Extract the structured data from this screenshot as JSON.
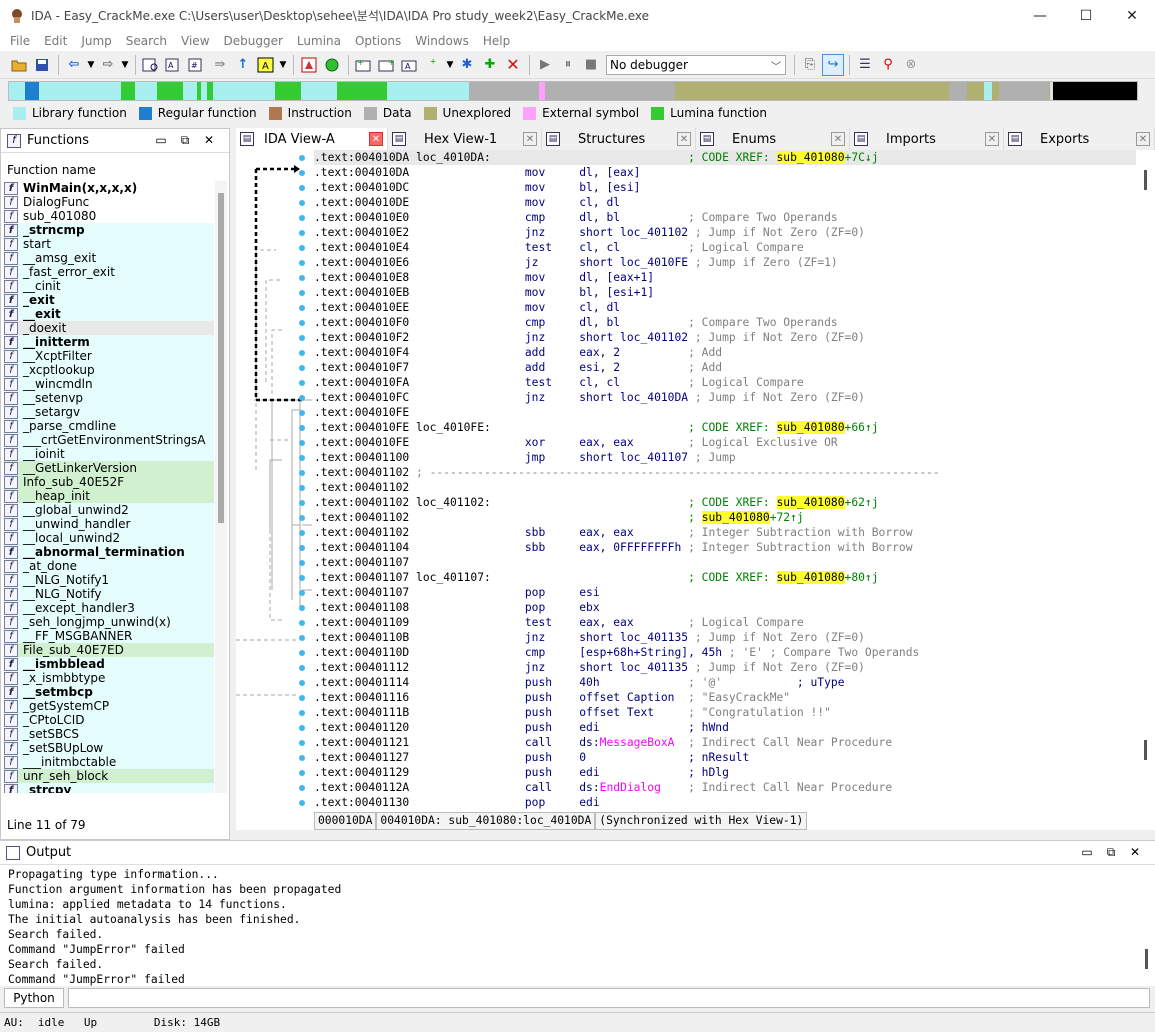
{
  "window": {
    "title": "IDA - Easy_CrackMe.exe C:\\Users\\user\\Desktop\\sehee\\분석\\IDA\\IDA Pro study_week2\\Easy_CrackMe.exe",
    "minimize": "—",
    "maximize": "☐",
    "close": "✕"
  },
  "menu": [
    "File",
    "Edit",
    "Jump",
    "Search",
    "View",
    "Debugger",
    "Lumina",
    "Options",
    "Windows",
    "Help"
  ],
  "toolbar": {
    "debugger_select": "No debugger"
  },
  "legend": [
    {
      "label": "Library function",
      "color": "#a8f0f0"
    },
    {
      "label": "Regular function",
      "color": "#1e7fd0"
    },
    {
      "label": "Instruction",
      "color": "#b07850"
    },
    {
      "label": "Data",
      "color": "#b0b0b0"
    },
    {
      "label": "Unexplored",
      "color": "#b0b070"
    },
    {
      "label": "External symbol",
      "color": "#ffa0ff"
    },
    {
      "label": "Lumina function",
      "color": "#33cc33"
    }
  ],
  "functions_panel": {
    "title": "Functions",
    "column_header": "Function name",
    "status": "Line 11 of 79",
    "items": [
      {
        "name": "WinMain(x,x,x,x)",
        "style": "b"
      },
      {
        "name": "DialogFunc",
        "style": ""
      },
      {
        "name": "sub_401080",
        "style": ""
      },
      {
        "name": "_strncmp",
        "style": "lib b"
      },
      {
        "name": "start",
        "style": "lib"
      },
      {
        "name": "__amsg_exit",
        "style": "lib"
      },
      {
        "name": "_fast_error_exit",
        "style": "lib"
      },
      {
        "name": "__cinit",
        "style": "lib"
      },
      {
        "name": "_exit",
        "style": "lib b"
      },
      {
        "name": "__exit",
        "style": "lib b"
      },
      {
        "name": "_doexit",
        "style": "sel"
      },
      {
        "name": "__initterm",
        "style": "lib b"
      },
      {
        "name": "__XcptFilter",
        "style": "lib"
      },
      {
        "name": "_xcptlookup",
        "style": "lib"
      },
      {
        "name": "__wincmdln",
        "style": "lib"
      },
      {
        "name": "__setenvp",
        "style": "lib"
      },
      {
        "name": "__setargv",
        "style": "lib"
      },
      {
        "name": "_parse_cmdline",
        "style": "lib"
      },
      {
        "name": "___crtGetEnvironmentStringsA",
        "style": "lib"
      },
      {
        "name": "__ioinit",
        "style": "lib"
      },
      {
        "name": "__GetLinkerVersion",
        "style": "lum"
      },
      {
        "name": "Info_sub_40E52F",
        "style": "lum"
      },
      {
        "name": "__heap_init",
        "style": "lum"
      },
      {
        "name": "__global_unwind2",
        "style": "lib"
      },
      {
        "name": "__unwind_handler",
        "style": "lib"
      },
      {
        "name": "__local_unwind2",
        "style": "lib"
      },
      {
        "name": "__abnormal_termination",
        "style": "lib b"
      },
      {
        "name": "_at_done",
        "style": "lib"
      },
      {
        "name": "__NLG_Notify1",
        "style": "lib"
      },
      {
        "name": "__NLG_Notify",
        "style": "lib"
      },
      {
        "name": "__except_handler3",
        "style": "lib"
      },
      {
        "name": "_seh_longjmp_unwind(x)",
        "style": "lib"
      },
      {
        "name": "__FF_MSGBANNER",
        "style": "lib"
      },
      {
        "name": "File_sub_40E7ED",
        "style": "lum"
      },
      {
        "name": "__ismbblead",
        "style": "lib b"
      },
      {
        "name": "_x_ismbbtype",
        "style": "lib"
      },
      {
        "name": "__setmbcp",
        "style": "lib b"
      },
      {
        "name": "_getSystemCP",
        "style": "lib"
      },
      {
        "name": "_CPtoLCID",
        "style": "lib"
      },
      {
        "name": "_setSBCS",
        "style": "lib"
      },
      {
        "name": "_setSBUpLow",
        "style": "lib"
      },
      {
        "name": "___initmbctable",
        "style": "lib"
      },
      {
        "name": "unr_seh_block",
        "style": "lum"
      },
      {
        "name": "_strcpy",
        "style": "lib b"
      }
    ]
  },
  "tabs": [
    {
      "label": "IDA View-A",
      "icon": "ida-view-icon",
      "active": true
    },
    {
      "label": "Hex View-1",
      "icon": "hex-view-icon",
      "active": false
    },
    {
      "label": "Structures",
      "icon": "structures-icon",
      "active": false
    },
    {
      "label": "Enums",
      "icon": "enums-icon",
      "active": false
    },
    {
      "label": "Imports",
      "icon": "imports-icon",
      "active": false
    },
    {
      "label": "Exports",
      "icon": "exports-icon",
      "active": false
    }
  ],
  "disasm": [
    [
      {
        "t": ".text:004010DA loc_4010DA:                             ",
        "c": "addr"
      },
      {
        "t": "; CODE XREF: ",
        "c": "xr"
      },
      {
        "t": "sub_401080",
        "c": "hl"
      },
      {
        "t": "+7C↓j",
        "c": "xr"
      }
    ],
    [
      {
        "t": ".text:004010DA                 ",
        "c": "addr"
      },
      {
        "t": "mov     dl, [eax]",
        "c": "mn"
      }
    ],
    [
      {
        "t": ".text:004010DC                 ",
        "c": "addr"
      },
      {
        "t": "mov     bl, [esi]",
        "c": "mn"
      }
    ],
    [
      {
        "t": ".text:004010DE                 ",
        "c": "addr"
      },
      {
        "t": "mov     cl, dl",
        "c": "mn"
      }
    ],
    [
      {
        "t": ".text:004010E0                 ",
        "c": "addr"
      },
      {
        "t": "cmp     dl, bl          ",
        "c": "mn"
      },
      {
        "t": "; Compare Two Operands",
        "c": "cm"
      }
    ],
    [
      {
        "t": ".text:004010E2                 ",
        "c": "addr"
      },
      {
        "t": "jnz     short loc_401102 ",
        "c": "mn"
      },
      {
        "t": "; Jump if Not Zero (ZF=0)",
        "c": "cm"
      }
    ],
    [
      {
        "t": ".text:004010E4                 ",
        "c": "addr"
      },
      {
        "t": "test    cl, cl          ",
        "c": "mn"
      },
      {
        "t": "; Logical Compare",
        "c": "cm"
      }
    ],
    [
      {
        "t": ".text:004010E6                 ",
        "c": "addr"
      },
      {
        "t": "jz      short loc_4010FE ",
        "c": "mn"
      },
      {
        "t": "; Jump if Zero (ZF=1)",
        "c": "cm"
      }
    ],
    [
      {
        "t": ".text:004010E8                 ",
        "c": "addr"
      },
      {
        "t": "mov     dl, [eax+1]",
        "c": "mn"
      }
    ],
    [
      {
        "t": ".text:004010EB                 ",
        "c": "addr"
      },
      {
        "t": "mov     bl, [esi+1]",
        "c": "mn"
      }
    ],
    [
      {
        "t": ".text:004010EE                 ",
        "c": "addr"
      },
      {
        "t": "mov     cl, dl",
        "c": "mn"
      }
    ],
    [
      {
        "t": ".text:004010F0                 ",
        "c": "addr"
      },
      {
        "t": "cmp     dl, bl          ",
        "c": "mn"
      },
      {
        "t": "; Compare Two Operands",
        "c": "cm"
      }
    ],
    [
      {
        "t": ".text:004010F2                 ",
        "c": "addr"
      },
      {
        "t": "jnz     short loc_401102 ",
        "c": "mn"
      },
      {
        "t": "; Jump if Not Zero (ZF=0)",
        "c": "cm"
      }
    ],
    [
      {
        "t": ".text:004010F4                 ",
        "c": "addr"
      },
      {
        "t": "add     eax, 2          ",
        "c": "mn"
      },
      {
        "t": "; Add",
        "c": "cm"
      }
    ],
    [
      {
        "t": ".text:004010F7                 ",
        "c": "addr"
      },
      {
        "t": "add     esi, 2          ",
        "c": "mn"
      },
      {
        "t": "; Add",
        "c": "cm"
      }
    ],
    [
      {
        "t": ".text:004010FA                 ",
        "c": "addr"
      },
      {
        "t": "test    cl, cl          ",
        "c": "mn"
      },
      {
        "t": "; Logical Compare",
        "c": "cm"
      }
    ],
    [
      {
        "t": ".text:004010FC                 ",
        "c": "addr"
      },
      {
        "t": "jnz     short loc_4010DA ",
        "c": "mn"
      },
      {
        "t": "; Jump if Not Zero (ZF=0)",
        "c": "cm"
      }
    ],
    [
      {
        "t": ".text:004010FE",
        "c": "addr"
      }
    ],
    [
      {
        "t": ".text:004010FE loc_4010FE:                             ",
        "c": "addr"
      },
      {
        "t": "; CODE XREF: ",
        "c": "xr"
      },
      {
        "t": "sub_401080",
        "c": "hl"
      },
      {
        "t": "+66↑j",
        "c": "xr"
      }
    ],
    [
      {
        "t": ".text:004010FE                 ",
        "c": "addr"
      },
      {
        "t": "xor     eax, eax        ",
        "c": "mn"
      },
      {
        "t": "; Logical Exclusive OR",
        "c": "cm"
      }
    ],
    [
      {
        "t": ".text:00401100                 ",
        "c": "addr"
      },
      {
        "t": "jmp     short loc_401107 ",
        "c": "mn"
      },
      {
        "t": "; Jump",
        "c": "cm"
      }
    ],
    [
      {
        "t": ".text:00401102 ",
        "c": "addr"
      },
      {
        "t": "; ---------------------------------------------------------------------------",
        "c": "cm"
      }
    ],
    [
      {
        "t": ".text:00401102",
        "c": "addr"
      }
    ],
    [
      {
        "t": ".text:00401102 loc_401102:                             ",
        "c": "addr"
      },
      {
        "t": "; CODE XREF: ",
        "c": "xr"
      },
      {
        "t": "sub_401080",
        "c": "hl"
      },
      {
        "t": "+62↑j",
        "c": "xr"
      }
    ],
    [
      {
        "t": ".text:00401102                                         ",
        "c": "addr"
      },
      {
        "t": "; ",
        "c": "xr"
      },
      {
        "t": "sub_401080",
        "c": "hl"
      },
      {
        "t": "+72↑j",
        "c": "xr"
      }
    ],
    [
      {
        "t": ".text:00401102                 ",
        "c": "addr"
      },
      {
        "t": "sbb     eax, eax        ",
        "c": "mn"
      },
      {
        "t": "; Integer Subtraction with Borrow",
        "c": "cm"
      }
    ],
    [
      {
        "t": ".text:00401104                 ",
        "c": "addr"
      },
      {
        "t": "sbb     eax, 0FFFFFFFFh ",
        "c": "mn"
      },
      {
        "t": "; Integer Subtraction with Borrow",
        "c": "cm"
      }
    ],
    [
      {
        "t": ".text:00401107",
        "c": "addr"
      }
    ],
    [
      {
        "t": ".text:00401107 loc_401107:                             ",
        "c": "addr"
      },
      {
        "t": "; CODE XREF: ",
        "c": "xr"
      },
      {
        "t": "sub_401080",
        "c": "hl"
      },
      {
        "t": "+80↑j",
        "c": "xr"
      }
    ],
    [
      {
        "t": ".text:00401107                 ",
        "c": "addr"
      },
      {
        "t": "pop     esi",
        "c": "mn"
      }
    ],
    [
      {
        "t": ".text:00401108                 ",
        "c": "addr"
      },
      {
        "t": "pop     ebx",
        "c": "mn"
      }
    ],
    [
      {
        "t": ".text:00401109                 ",
        "c": "addr"
      },
      {
        "t": "test    eax, eax        ",
        "c": "mn"
      },
      {
        "t": "; Logical Compare",
        "c": "cm"
      }
    ],
    [
      {
        "t": ".text:0040110B                 ",
        "c": "addr"
      },
      {
        "t": "jnz     short loc_401135 ",
        "c": "mn"
      },
      {
        "t": "; Jump if Not Zero (ZF=0)",
        "c": "cm"
      }
    ],
    [
      {
        "t": ".text:0040110D                 ",
        "c": "addr"
      },
      {
        "t": "cmp     [esp+68h+String], 45h ",
        "c": "mn"
      },
      {
        "t": "; 'E' ; Compare Two Operands",
        "c": "cm"
      }
    ],
    [
      {
        "t": ".text:00401112                 ",
        "c": "addr"
      },
      {
        "t": "jnz     short loc_401135 ",
        "c": "mn"
      },
      {
        "t": "; Jump if Not Zero (ZF=0)",
        "c": "cm"
      }
    ],
    [
      {
        "t": ".text:00401114                 ",
        "c": "addr"
      },
      {
        "t": "push    40h             ",
        "c": "mn"
      },
      {
        "t": "; '@'           ",
        "c": "cm"
      },
      {
        "t": "; uType",
        "c": "mn"
      }
    ],
    [
      {
        "t": ".text:00401116                 ",
        "c": "addr"
      },
      {
        "t": "push    offset Caption  ",
        "c": "mn"
      },
      {
        "t": "; \"EasyCrackMe\"",
        "c": "cm"
      }
    ],
    [
      {
        "t": ".text:0040111B                 ",
        "c": "addr"
      },
      {
        "t": "push    offset Text     ",
        "c": "mn"
      },
      {
        "t": "; \"Congratulation !!\"",
        "c": "cm"
      }
    ],
    [
      {
        "t": ".text:00401120                 ",
        "c": "addr"
      },
      {
        "t": "push    edi             ; hWnd",
        "c": "mn"
      }
    ],
    [
      {
        "t": ".text:00401121                 ",
        "c": "addr"
      },
      {
        "t": "call    ds:",
        "c": "mn"
      },
      {
        "t": "MessageBoxA",
        "c": "api"
      },
      {
        "t": "  ",
        "c": "mn"
      },
      {
        "t": "; Indirect Call Near Procedure",
        "c": "cm"
      }
    ],
    [
      {
        "t": ".text:00401127                 ",
        "c": "addr"
      },
      {
        "t": "push    0               ; nResult",
        "c": "mn"
      }
    ],
    [
      {
        "t": ".text:00401129                 ",
        "c": "addr"
      },
      {
        "t": "push    edi             ; hDlg",
        "c": "mn"
      }
    ],
    [
      {
        "t": ".text:0040112A                 ",
        "c": "addr"
      },
      {
        "t": "call    ds:",
        "c": "mn"
      },
      {
        "t": "EndDialog",
        "c": "api"
      },
      {
        "t": "    ",
        "c": "mn"
      },
      {
        "t": "; Indirect Call Near Procedure",
        "c": "cm"
      }
    ],
    [
      {
        "t": ".text:00401130                 ",
        "c": "addr"
      },
      {
        "t": "pop     edi",
        "c": "mn"
      }
    ]
  ],
  "disasm_status": [
    "000010DA",
    "004010DA: sub_401080:loc_4010DA",
    "(Synchronized with Hex View-1)"
  ],
  "output_panel": {
    "title": "Output",
    "lines": [
      "Propagating type information...",
      "Function argument information has been propagated",
      "lumina: applied metadata to 14 functions.",
      "The initial autoanalysis has been finished.",
      "Search failed.",
      "Command \"JumpError\" failed",
      "Search failed.",
      "Command \"JumpError\" failed"
    ]
  },
  "python_button": "Python",
  "statusbar": {
    "au": "AU:",
    "state": "idle",
    "dir": "Up",
    "disk": "Disk: 14GB"
  }
}
